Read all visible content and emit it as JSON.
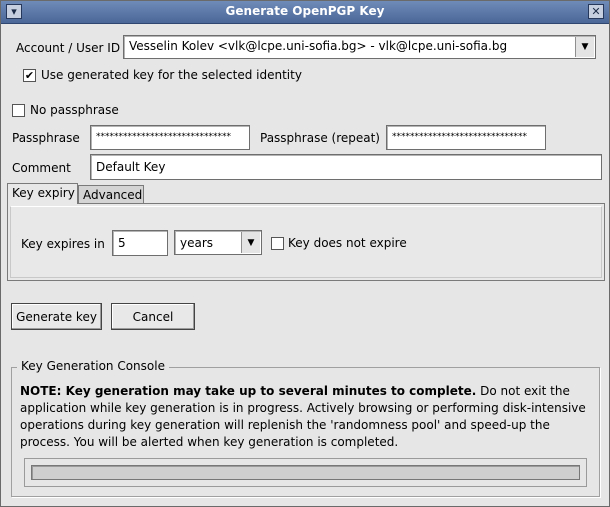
{
  "window": {
    "title": "Generate OpenPGP Key",
    "menu_glyph": "▾",
    "close_glyph": "✕"
  },
  "account": {
    "label": "Account / User ID",
    "selected": "Vesselin Kolev <vlk@lcpe.uni-sofia.bg> - vlk@lcpe.uni-sofia.bg",
    "use_generated_label": "Use generated key for the selected identity",
    "use_generated_checked": true
  },
  "passphrase": {
    "no_passphrase_label": "No passphrase",
    "no_passphrase_checked": false,
    "label": "Passphrase",
    "value": "******************************",
    "repeat_label": "Passphrase (repeat)",
    "repeat_value": "******************************"
  },
  "comment": {
    "label": "Comment",
    "value": "Default Key"
  },
  "tabs": [
    {
      "label": "Key expiry",
      "active": true
    },
    {
      "label": "Advanced",
      "active": false
    }
  ],
  "expiry": {
    "label": "Key expires in",
    "amount": "5",
    "unit": "years",
    "no_expire_label": "Key does not expire",
    "no_expire_checked": false
  },
  "buttons": {
    "generate": "Generate key",
    "cancel": "Cancel"
  },
  "console": {
    "title": "Key Generation Console",
    "note_bold": "NOTE: Key generation may take up to several minutes to complete.",
    "note_rest": " Do not exit the application while key generation is in progress. Actively browsing or performing disk-intensive operations during key generation will replenish the 'randomness pool' and speed-up the process. You will be alerted when key generation is completed.",
    "progress": 0
  },
  "glyphs": {
    "check": "✔",
    "dropdown": "▼"
  }
}
